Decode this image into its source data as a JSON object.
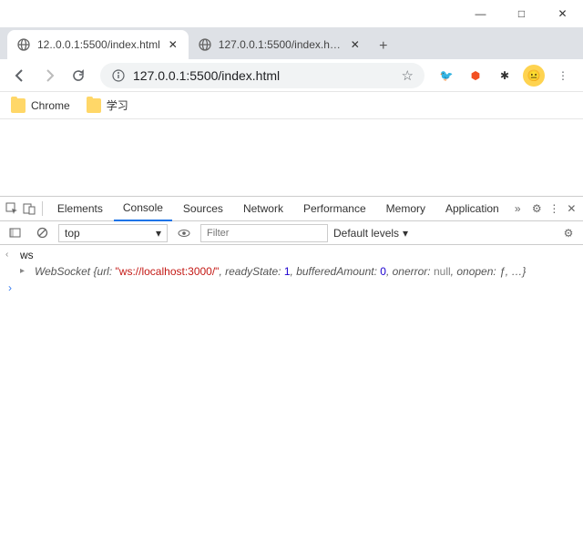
{
  "window": {
    "minimize": "—",
    "maximize": "□",
    "close": "✕"
  },
  "tabs": [
    {
      "title": "12..0.0.1:5500/index.html"
    },
    {
      "title": "127.0.0.1:5500/index.html"
    }
  ],
  "omnibox": {
    "url": "127.0.0.1:5500/index.html"
  },
  "bookmarks": [
    {
      "label": "Chrome"
    },
    {
      "label": "学习"
    }
  ],
  "avatar": {
    "emoji": "😐"
  },
  "devtools": {
    "tabs": [
      "Elements",
      "Console",
      "Sources",
      "Network",
      "Performance",
      "Memory",
      "Application"
    ],
    "context": "top",
    "filter_placeholder": "Filter",
    "levels": "Default levels",
    "lines": {
      "input": "ws",
      "obj": "WebSocket",
      "brace_open": "{",
      "k_url": "url:",
      "v_url": "\"ws://localhost:3000/\"",
      "k_ready": ", readyState:",
      "v_ready": "1",
      "k_buf": ", bufferedAmount:",
      "v_buf": "0",
      "k_err": ", onerror:",
      "v_err": "null",
      "k_open": ", onopen:",
      "v_open": "ƒ",
      "tail": ", …}"
    }
  }
}
